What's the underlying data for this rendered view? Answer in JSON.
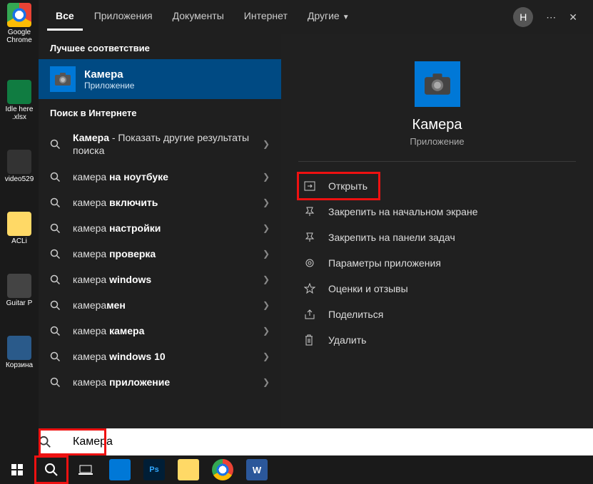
{
  "desktop_icons": [
    {
      "label": "Google Chrome",
      "kind": "chrome"
    },
    {
      "label": "Idle here .xlsx",
      "kind": "xlsx"
    },
    {
      "label": "video529",
      "kind": "video"
    },
    {
      "label": "ACLi",
      "kind": "aclib"
    },
    {
      "label": "Guitar P",
      "kind": "guitar"
    },
    {
      "label": "Корзина",
      "kind": "trash"
    }
  ],
  "tabs": {
    "items": [
      "Все",
      "Приложения",
      "Документы",
      "Интернет",
      "Другие"
    ],
    "active_index": 0,
    "more_has_caret": true
  },
  "avatar_letter": "Н",
  "sections": {
    "best_match_header": "Лучшее соответствие",
    "web_header": "Поиск в Интернете"
  },
  "best_match": {
    "title": "Камера",
    "subtitle": "Приложение",
    "icon": "camera"
  },
  "web_results": [
    {
      "prefix": "",
      "bold": "Камера",
      "trail": " - Показать другие результаты поиска"
    },
    {
      "prefix": "камера ",
      "bold": "на ноутбуке",
      "trail": ""
    },
    {
      "prefix": "камера ",
      "bold": "включить",
      "trail": ""
    },
    {
      "prefix": "камера ",
      "bold": "настройки",
      "trail": ""
    },
    {
      "prefix": "камера ",
      "bold": "проверка",
      "trail": ""
    },
    {
      "prefix": "камера ",
      "bold": "windows",
      "trail": ""
    },
    {
      "prefix": "камера",
      "bold": "мен",
      "trail": ""
    },
    {
      "prefix": "камера ",
      "bold": "камера",
      "trail": ""
    },
    {
      "prefix": "камера ",
      "bold": "windows 10",
      "trail": ""
    },
    {
      "prefix": "камера ",
      "bold": "приложение",
      "trail": ""
    }
  ],
  "preview": {
    "title": "Камера",
    "subtitle": "Приложение"
  },
  "actions": [
    {
      "icon": "open",
      "label": "Открыть",
      "highlight": true
    },
    {
      "icon": "pin-start",
      "label": "Закрепить на начальном экране",
      "highlight": false
    },
    {
      "icon": "pin-task",
      "label": "Закрепить на панели задач",
      "highlight": false
    },
    {
      "icon": "settings",
      "label": "Параметры приложения",
      "highlight": false
    },
    {
      "icon": "star",
      "label": "Оценки и отзывы",
      "highlight": false
    },
    {
      "icon": "share",
      "label": "Поделиться",
      "highlight": false
    },
    {
      "icon": "trash",
      "label": "Удалить",
      "highlight": false
    }
  ],
  "search_input": {
    "value": "Камера",
    "placeholder": ""
  },
  "taskbar": {
    "items": [
      "start",
      "search",
      "taskview",
      "calc",
      "ps",
      "explorer",
      "chrome",
      "word"
    ]
  }
}
